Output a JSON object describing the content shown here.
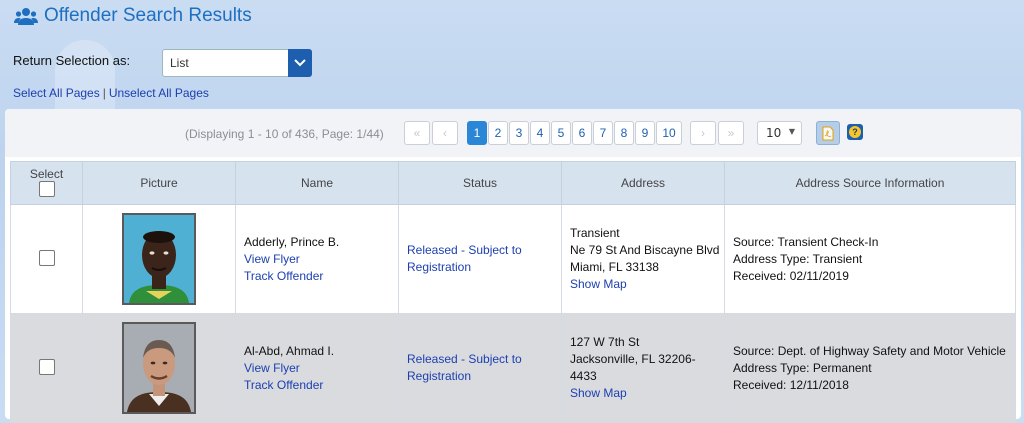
{
  "header": {
    "title": "Offender Search Results"
  },
  "return_selection": {
    "label": "Return Selection as:",
    "value": "List"
  },
  "selection_links": {
    "select_all": "Select All Pages",
    "separator": "|",
    "unselect_all": "Unselect All Pages"
  },
  "pager": {
    "display_text": "(Displaying 1 - 10 of 436, Page: 1/44)",
    "first": "«",
    "prev": "‹",
    "next": "›",
    "last": "»",
    "pages": [
      "1",
      "2",
      "3",
      "4",
      "5",
      "6",
      "7",
      "8",
      "9",
      "10"
    ],
    "active_page": "1",
    "per_page": "10"
  },
  "table": {
    "headers": {
      "select": "Select",
      "picture": "Picture",
      "name": "Name",
      "status": "Status",
      "address": "Address",
      "source": "Address Source Information"
    },
    "rows": [
      {
        "name": "Adderly, Prince B.",
        "flyer": "View Flyer",
        "track": "Track Offender",
        "status": "Released - Subject to Registration",
        "addr1": "Transient",
        "addr2": "Ne 79 St And Biscayne Blvd",
        "addr3": "Miami, FL 33138",
        "map": "Show Map",
        "source_label": "Source:",
        "source": "Transient Check-In",
        "type_label": "Address Type:",
        "type": "Transient",
        "recv_label": "Received:",
        "received": "02/11/2019"
      },
      {
        "name": "Al-Abd, Ahmad I.",
        "flyer": "View Flyer",
        "track": "Track Offender",
        "status": "Released - Subject to Registration",
        "addr1": "127 W 7th St",
        "addr2": "Jacksonville, FL 32206-",
        "addr3": "4433",
        "map": "Show Map",
        "source_label": "Source:",
        "source": "Dept. of Highway Safety and Motor Vehicle",
        "type_label": "Address Type:",
        "type": "Permanent",
        "recv_label": "Received:",
        "received": "12/11/2018"
      }
    ]
  }
}
